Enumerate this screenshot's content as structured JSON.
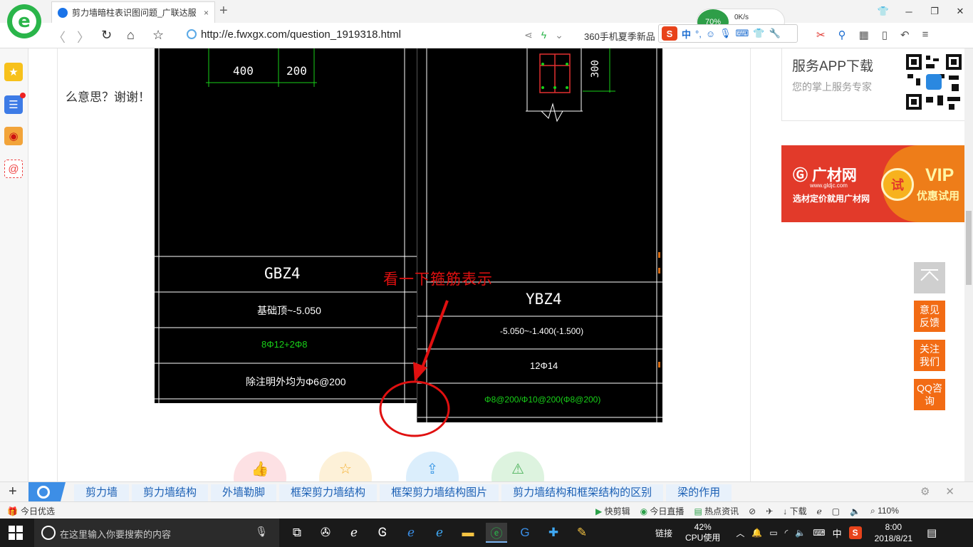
{
  "browser": {
    "tab_title": "剪力墙暗柱表识图问题_广联达服",
    "tab_close": "×",
    "new_tab": "+",
    "url": "http://e.fwxgx.com/question_1919318.html",
    "news_ticker": "360手机夏季新品",
    "cpu_widget": "70%",
    "net_speed": "0K/s"
  },
  "ime": {
    "logo": "S",
    "mode": "中"
  },
  "page": {
    "question_tail": "么意思？谢谢！",
    "annotation": "看一下箍筋表示"
  },
  "cad_left": {
    "dim_1": "400",
    "dim_2": "200",
    "name": "GBZ4",
    "elevation": "基础顶~-5.050",
    "longitudinal": "8Φ12+2Φ8",
    "stirrup": "除注明外均为Φ6@200"
  },
  "cad_right": {
    "dim": "300",
    "name": "YBZ4",
    "elevation": "-5.050~-1.400(-1.500)",
    "longitudinal": "12Φ14",
    "stirrup": "Φ8@200/Φ10@200(Φ8@200)"
  },
  "sidebar_app": {
    "title": "服务APP下载",
    "desc": "您的掌上服务专家"
  },
  "ad": {
    "brand": "广材网",
    "site": "www.gldjc.com",
    "slogan": "选材定价就用广材网",
    "badge": "试",
    "vip": "VIP",
    "trial": "优惠试用"
  },
  "float_buttons": {
    "feedback": "意见反馈",
    "follow": "关注我们",
    "qq": "QQ咨询"
  },
  "hot_tags": [
    "剪力墙",
    "剪力墙结构",
    "外墙勒脚",
    "框架剪力墙结构",
    "框架剪力墙结构图片",
    "剪力墙结构和框架结构的区别",
    "梁的作用"
  ],
  "statusbar": {
    "left": "今日优选",
    "clip": "快剪辑",
    "live": "今日直播",
    "news": "热点资讯",
    "download": "下载",
    "zoom": "110%"
  },
  "taskbar": {
    "search_placeholder": "在这里输入你要搜索的内容",
    "link": "链接",
    "cpu_pct": "42%",
    "cpu_label": "CPU使用",
    "ime": "中",
    "time": "8:00",
    "date": "2018/8/21"
  }
}
